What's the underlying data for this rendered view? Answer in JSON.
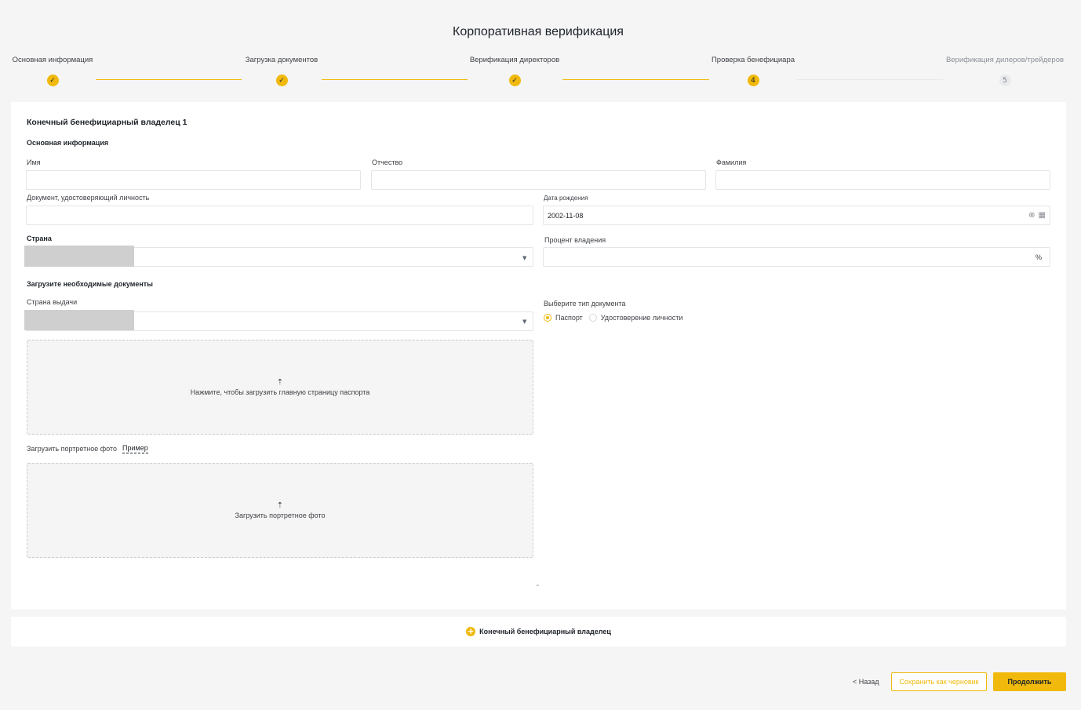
{
  "page": {
    "title": "Корпоративная верификация"
  },
  "stepper": {
    "steps": [
      {
        "label": "Основная информация",
        "status": "done",
        "marker": "✓"
      },
      {
        "label": "Загрузка документов",
        "status": "done",
        "marker": "✓"
      },
      {
        "label": "Верификация директоров",
        "status": "done",
        "marker": "✓"
      },
      {
        "label": "Проверка бенефициара",
        "status": "current",
        "marker": "4"
      },
      {
        "label": "Верификация дилеров/трейдеров",
        "status": "future",
        "marker": "5"
      }
    ]
  },
  "owner_form": {
    "title": "Конечный бенефициарный владелец 1",
    "basic_info_title": "Основная информация",
    "first_name_label": "Имя",
    "first_name_value": "",
    "patronymic_label": "Отчество",
    "patronymic_value": "",
    "last_name_label": "Фамилия",
    "last_name_value": "",
    "id_document_label": "Документ, удостоверяющий личность",
    "id_document_value": "",
    "birth_date_label": "Дата рождения",
    "birth_date_value": "2002-11-08",
    "country_label": "Страна",
    "ownership_label": "Процент владения",
    "ownership_value": "",
    "ownership_suffix": "%",
    "documents_title": "Загрузите необходимые документы",
    "issue_country_label": "Страна выдачи",
    "doc_type_label": "Выберите тип документа",
    "doc_type_options": [
      "Паспорт",
      "Удостоверение личности"
    ],
    "doc_type_selected": "Паспорт",
    "passport_upload_text": "Нажмите, чтобы загрузить главную страницу паспорта",
    "portrait_label": "Загрузить портретное фото",
    "portrait_example": "Пример",
    "portrait_upload_text": "Загрузить портретное фото"
  },
  "add_owner": {
    "label": "Конечный бенефициарный владелец"
  },
  "footer": {
    "back_label": "< Назад",
    "save_draft_label": "Сохранить как черновик",
    "continue_label": "Продолжить"
  },
  "colors": {
    "accent": "#f0b90b",
    "background": "#f5f5f5",
    "card": "#ffffff"
  },
  "icons": [
    "check-icon",
    "clear-icon",
    "calendar-icon",
    "dropdown-arrow-icon",
    "upload-icon",
    "collapse-icon",
    "add-icon"
  ]
}
